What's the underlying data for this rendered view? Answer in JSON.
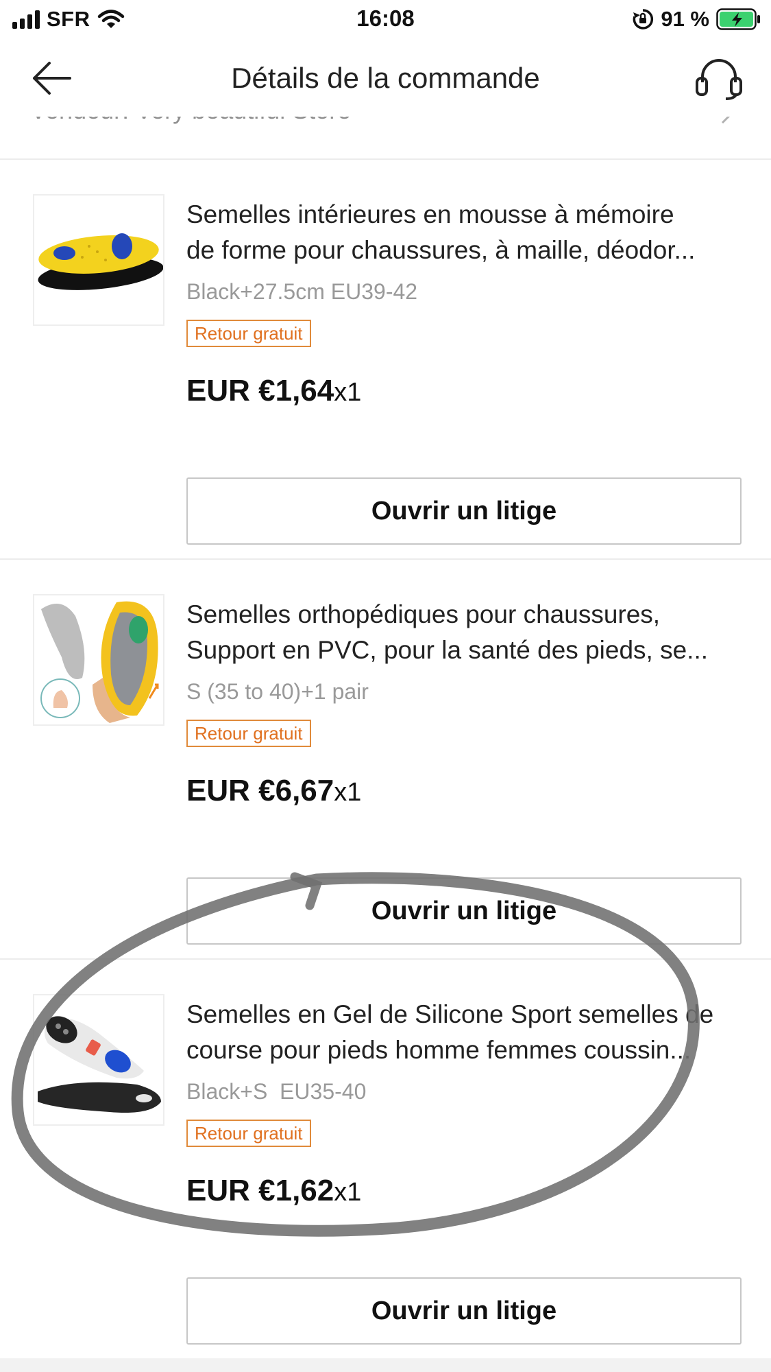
{
  "status_bar": {
    "carrier": "SFR",
    "time": "16:08",
    "battery": "91 %"
  },
  "header": {
    "title": "Détails de la commande",
    "cut_seller_text": "Vendeur: Very beautiful Store"
  },
  "items": [
    {
      "title_line1": "Semelles intérieures en mousse à mémoire",
      "title_line2": "de forme pour chaussures, à maille, déodor...",
      "variant": "Black+27.5cm EU39-42",
      "badge": "Retour gratuit",
      "price": "EUR €1,64",
      "qty": "x1",
      "button": "Ouvrir un litige"
    },
    {
      "title_line1": "Semelles orthopédiques pour chaussures,",
      "title_line2": "Support en PVC, pour la santé des pieds, se...",
      "variant": "S (35 to 40)+1 pair",
      "badge": "Retour gratuit",
      "price": "EUR €6,67",
      "qty": "x1",
      "button": "Ouvrir un litige"
    },
    {
      "title_line1": "Semelles en Gel de Silicone Sport semelles de",
      "title_line2": "course pour pieds homme femmes coussin...",
      "variant": "Black+S  EU35-40",
      "badge": "Retour gratuit",
      "price": "EUR €1,62",
      "qty": "x1",
      "button": "Ouvrir un litige"
    }
  ],
  "colors": {
    "badge_border": "#e08a3a",
    "badge_text": "#e0701f",
    "variant_text": "#999999",
    "scribble": "#6f6f6f"
  },
  "icons": [
    "back-arrow-icon",
    "headset-icon",
    "chevron-right-icon",
    "wifi-icon",
    "rotation-lock-icon",
    "battery-charging-icon"
  ]
}
